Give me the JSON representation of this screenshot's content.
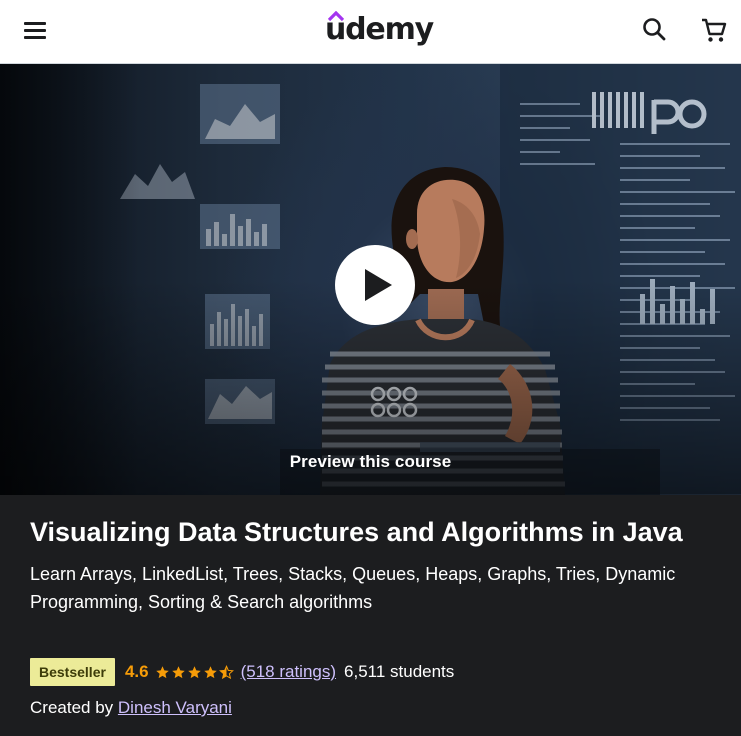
{
  "header": {
    "logo_text": "udemy",
    "menu_icon": "hamburger-menu-icon",
    "search_icon": "search-icon",
    "cart_icon": "cart-icon",
    "brand_color": "#a435f0"
  },
  "preview": {
    "label": "Preview this course",
    "play_icon": "play-icon"
  },
  "course": {
    "title": "Visualizing Data Structures and Algorithms in Java",
    "subtitle": "Learn Arrays, LinkedList, Trees, Stacks, Queues, Heaps, Graphs, Tries, Dynamic Programming, Sorting & Search algorithms",
    "badge": "Bestseller",
    "rating": "4.6",
    "stars": 4.6,
    "ratings_text": "(518 ratings)",
    "students_text": "6,511 students",
    "created_by_label": "Created by",
    "instructor": "Dinesh Varyani"
  },
  "colors": {
    "dark_bg": "#1c1d1f",
    "badge_bg": "#eceb98",
    "rating_orange": "#f69c08",
    "link_purple": "#cec0fc"
  }
}
